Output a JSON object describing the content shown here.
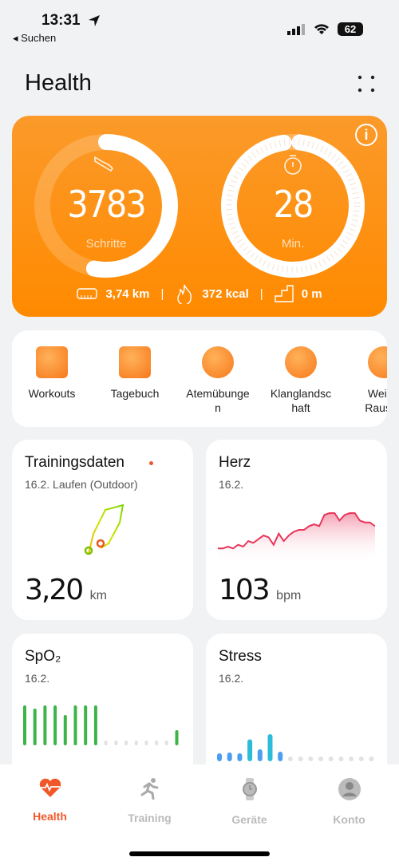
{
  "status": {
    "time": "13:31",
    "back": "◂ Suchen",
    "battery": "62"
  },
  "header": {
    "title": "Health",
    "menu_icon": "grid-dots-icon"
  },
  "activity": {
    "steps": "3783",
    "steps_label": "Schritte",
    "steps_progress": 0.53,
    "minutes": "28",
    "minutes_label": "Min.",
    "minutes_progress": 0.96,
    "distance": "3,74 km",
    "calories": "372 kcal",
    "floors": "0 m",
    "separator": "|"
  },
  "shortcuts": [
    {
      "label": "Workouts"
    },
    {
      "label": "Tagebuch"
    },
    {
      "label": "Atemübunge\nn"
    },
    {
      "label": "Klanglandsc\nhaft"
    },
    {
      "label": "Weiße\nRausch"
    }
  ],
  "cards": {
    "training": {
      "title": "Trainingsdaten",
      "subtitle": "16.2. Laufen (Outdoor)",
      "value": "3,20",
      "unit": "km"
    },
    "heart": {
      "title": "Herz",
      "subtitle": "16.2.",
      "value": "103",
      "unit": "bpm",
      "color": "#e8365a"
    },
    "spo2": {
      "title": "SpO₂",
      "subtitle": "16.2.",
      "color": "#3cb44a"
    },
    "stress": {
      "title": "Stress",
      "subtitle": "16.2."
    }
  },
  "chart_data": [
    {
      "type": "line",
      "name": "heart",
      "values": [
        78,
        78,
        79,
        78,
        80,
        79,
        82,
        81,
        83,
        85,
        84,
        80,
        86,
        82,
        85,
        87,
        88,
        88,
        90,
        91,
        90,
        96,
        97,
        97,
        93,
        96,
        97,
        97,
        93,
        92,
        92,
        90
      ]
    },
    {
      "type": "bar",
      "name": "spo2",
      "values": [
        100,
        92,
        100,
        100,
        76,
        100,
        100,
        100,
        null,
        null,
        null,
        null,
        null,
        null,
        null,
        38
      ]
    },
    {
      "type": "bar",
      "name": "stress",
      "values": [
        20,
        22,
        20,
        55,
        30,
        68,
        24,
        null,
        null,
        null,
        null,
        null,
        null,
        null,
        null,
        null
      ]
    }
  ],
  "nav": [
    {
      "label": "Health",
      "active": true
    },
    {
      "label": "Training"
    },
    {
      "label": "Geräte"
    },
    {
      "label": "Konto"
    }
  ]
}
